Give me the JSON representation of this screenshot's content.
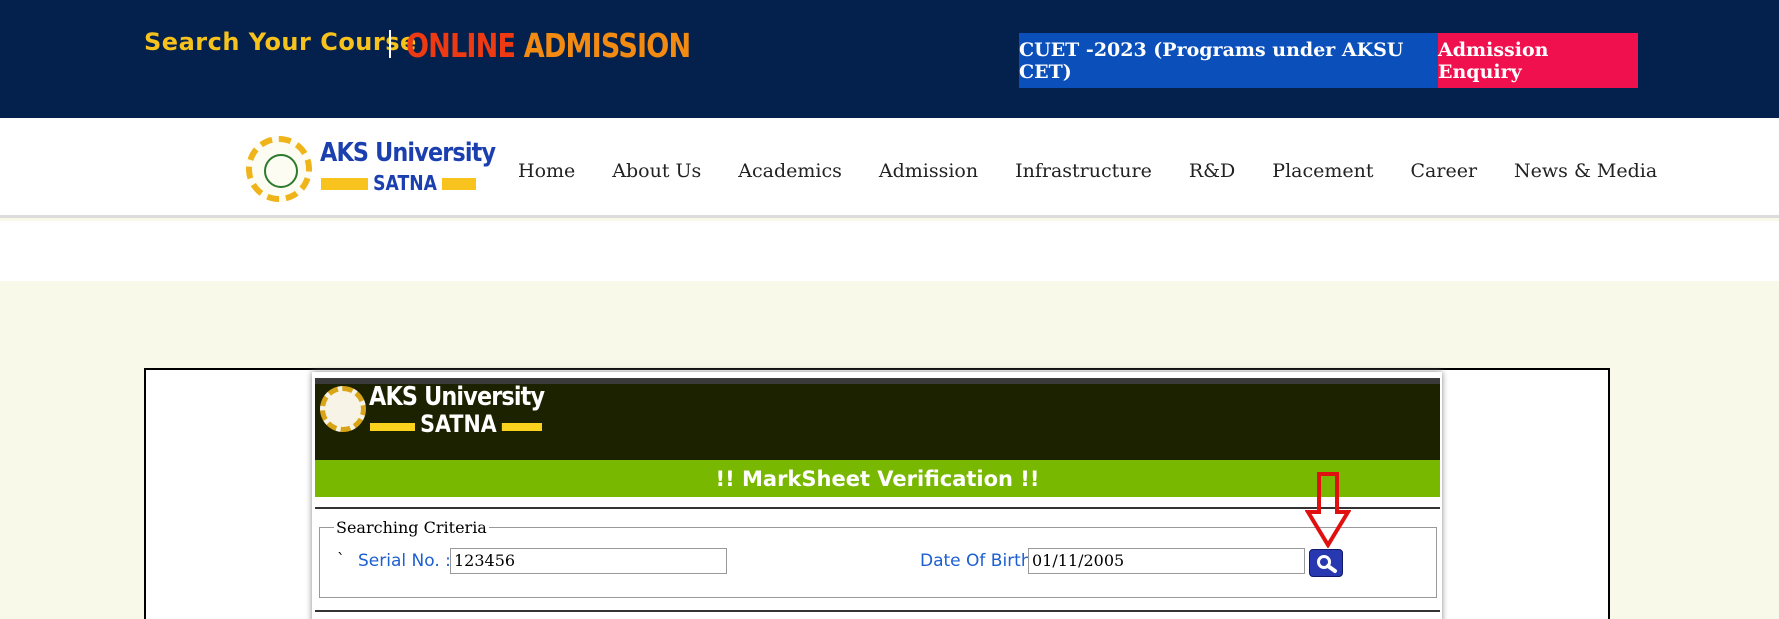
{
  "header": {
    "search_course": "Search Your Course",
    "online": "ONLINE",
    "admission": "ADMISSION",
    "cuet_button": "CUET -2023 (Programs under AKSU CET)",
    "enquiry_button": "Admission Enquiry"
  },
  "logo": {
    "name": "AKS University",
    "city": "SATNA"
  },
  "nav": {
    "items": [
      "Home",
      "About Us",
      "Academics",
      "Admission",
      "Infrastructure",
      "R&D",
      "Placement",
      "Career",
      "News & Media"
    ]
  },
  "verification": {
    "logo_name": "AKS University",
    "logo_city": "SATNA",
    "title": "!! MarkSheet Verification !!",
    "legend": "Searching Criteria",
    "tick": "`",
    "serial_label": "Serial No. :",
    "serial_value": "123456",
    "dob_label": "Date Of Birth",
    "dob_value": "01/11/2005"
  },
  "colors": {
    "topbar": "#03214c",
    "cuet": "#0a4fba",
    "enquiry": "#f0104e",
    "green_bar": "#79b800",
    "arrow": "#e01010"
  },
  "icons": {
    "search_button": "magnifier-icon",
    "annotation": "down-arrow-icon"
  }
}
